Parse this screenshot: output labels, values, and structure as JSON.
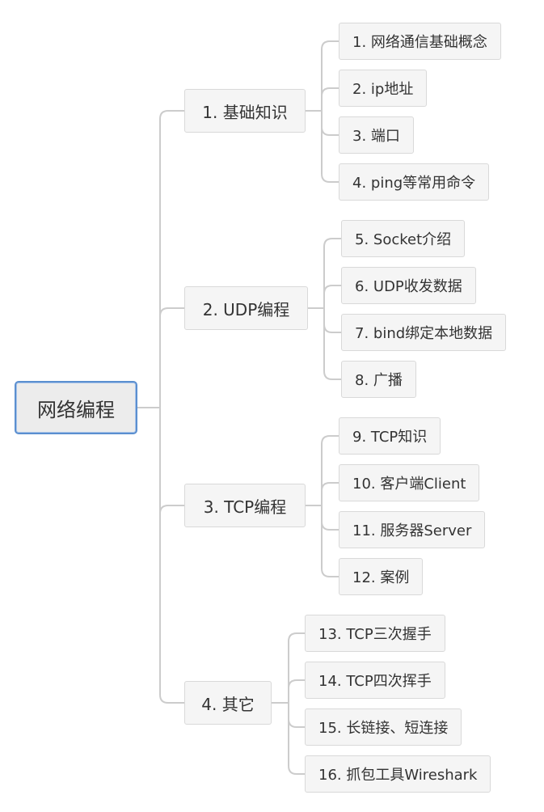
{
  "root": "网络编程",
  "branches": [
    {
      "label": "1. 基础知识",
      "children": [
        "1. 网络通信基础概念",
        "2. ip地址",
        "3. 端口",
        "4. ping等常用命令"
      ]
    },
    {
      "label": "2. UDP编程",
      "children": [
        "5. Socket介绍",
        "6. UDP收发数据",
        "7. bind绑定本地数据",
        "8. 广播"
      ]
    },
    {
      "label": "3. TCP编程",
      "children": [
        "9. TCP知识",
        "10. 客户端Client",
        "11. 服务器Server",
        "12. 案例"
      ]
    },
    {
      "label": "4. 其它",
      "children": [
        "13. TCP三次握手",
        "14. TCP四次挥手",
        "15. 长链接、短连接",
        "16. 抓包工具Wireshark"
      ]
    }
  ]
}
